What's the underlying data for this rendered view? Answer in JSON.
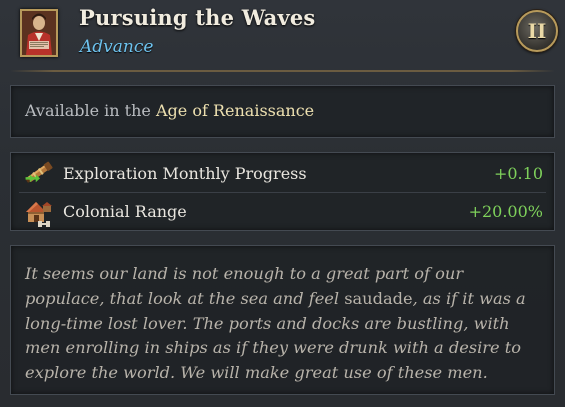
{
  "header": {
    "title": "Pursuing the Waves",
    "category": "Advance",
    "era_numeral": "II",
    "portrait_icon": "advisor-portrait-icon"
  },
  "availability": {
    "prefix": "Available in the",
    "age": "Age of Renaissance"
  },
  "modifiers": [
    {
      "label": "Exploration Monthly Progress",
      "value": "+0.10",
      "icon": "telescope-icon"
    },
    {
      "label": "Colonial Range",
      "value": "+20.00%",
      "icon": "colonial-settlement-icon"
    }
  ],
  "description": {
    "before_italic": "It seems our land is not enough to a great part of our populace, that look at the sea and feel ",
    "foreign_word": "saudade",
    "after_italic": ", as if it was a long-time lost lover. The ports and docks are bustling, with men enrolling in ships as if they were drunk with a desire to explore the world. We will make great use of these men."
  },
  "colors": {
    "title": "#f1ecdf",
    "category": "#6ec3ef",
    "highlight": "#ede0b0",
    "positive": "#7ed15b",
    "flavor": "#b8b3aa"
  }
}
